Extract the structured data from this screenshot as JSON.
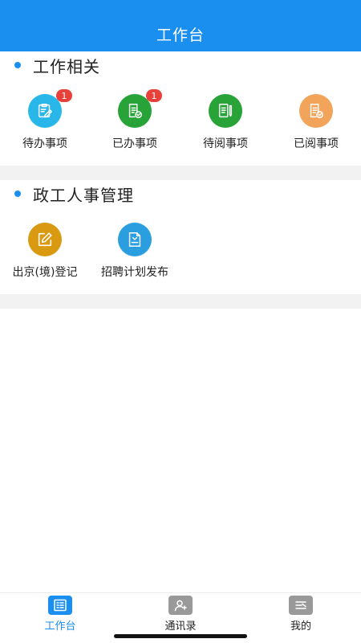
{
  "header": {
    "title": "工作台"
  },
  "sections": [
    {
      "title": "工作相关",
      "items": [
        {
          "label": "待办事项",
          "icon": "clipboard-edit-icon",
          "color": "#29b6e8",
          "badge": "1"
        },
        {
          "label": "已办事项",
          "icon": "document-check-icon",
          "color": "#27a338",
          "badge": "1"
        },
        {
          "label": "待阅事项",
          "icon": "document-pen-icon",
          "color": "#27a338",
          "badge": ""
        },
        {
          "label": "已阅事项",
          "icon": "document-check-icon",
          "color": "#f2a45b",
          "badge": ""
        }
      ]
    },
    {
      "title": "政工人事管理",
      "items": [
        {
          "label": "出京(境)登记",
          "icon": "edit-square-icon",
          "color": "#d99a12"
        },
        {
          "label": "招聘计划发布",
          "icon": "publish-document-icon",
          "color": "#2b9ee0"
        }
      ]
    }
  ],
  "tabbar": {
    "active_color": "#1a8ff0",
    "inactive_color": "#999999",
    "tabs": [
      {
        "label": "工作台",
        "icon": "workbench-icon",
        "active": true
      },
      {
        "label": "通讯录",
        "icon": "contacts-icon",
        "active": false
      },
      {
        "label": "我的",
        "icon": "profile-card-icon",
        "active": false
      }
    ]
  }
}
